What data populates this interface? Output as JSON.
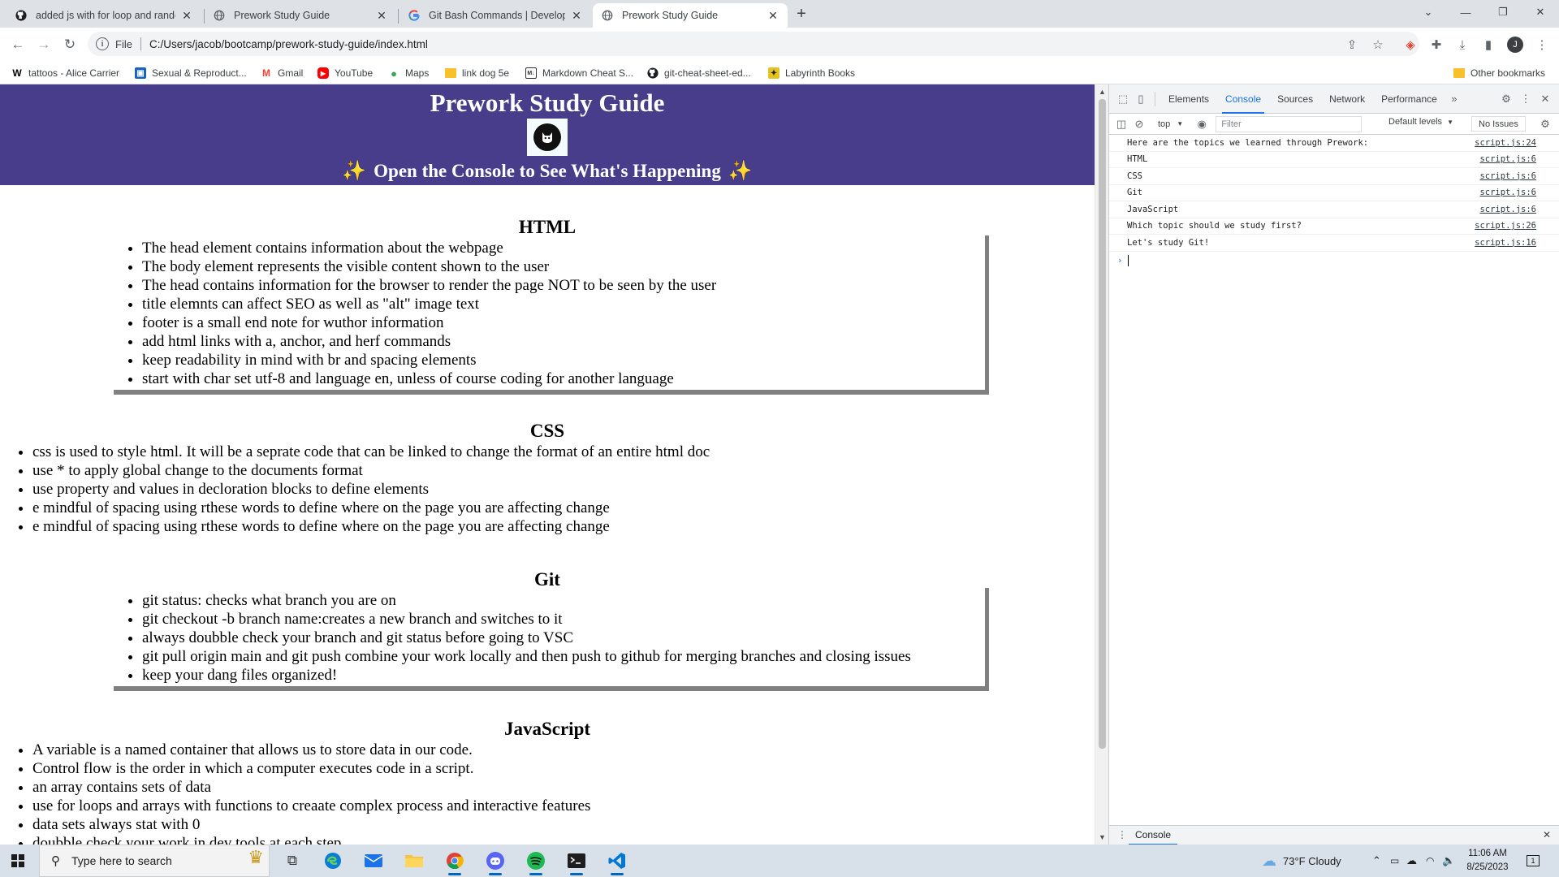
{
  "browser": {
    "tabs": [
      {
        "title": "added js with for loop and rando",
        "icon": "github-icon"
      },
      {
        "title": "Prework Study Guide",
        "icon": "globe-icon"
      },
      {
        "title": "Git Bash Commands | Developers",
        "icon": "google-icon"
      },
      {
        "title": "Prework Study Guide",
        "icon": "globe-icon",
        "active": true
      }
    ],
    "address": {
      "scheme": "File",
      "url": "C:/Users/jacob/bootcamp/prework-study-guide/index.html"
    },
    "profile_initial": "J",
    "bookmarks": [
      {
        "label": "tattoos - Alice Carrier",
        "icon": "w-logo-icon"
      },
      {
        "label": "Sexual & Reproduct...",
        "icon": "page-icon"
      },
      {
        "label": "Gmail",
        "icon": "gmail-icon"
      },
      {
        "label": "YouTube",
        "icon": "youtube-icon"
      },
      {
        "label": "Maps",
        "icon": "maps-icon"
      },
      {
        "label": "link dog 5e",
        "icon": "folder-icon"
      },
      {
        "label": "Markdown Cheat S...",
        "icon": "markdown-icon"
      },
      {
        "label": "git-cheat-sheet-ed...",
        "icon": "github-icon"
      },
      {
        "label": "Labyrinth Books",
        "icon": "labyrinth-icon"
      }
    ],
    "other_bookmarks": "Other bookmarks"
  },
  "page": {
    "title": "Prework Study Guide",
    "subtitle": "Open the Console to See What's Happening",
    "header_bg": "#483d8b",
    "sections": {
      "html": {
        "heading": "HTML",
        "items": [
          "The head element contains information about the webpage",
          "The body element represents the visible content shown to the user",
          "The head contains information for the browser to render the page NOT to be seen by the user",
          "title elemnts can affect SEO as well as \"alt\" image text",
          "footer is a small end note for wuthor information",
          "add html links with a, anchor, and herf commands",
          "keep readability in mind with br and spacing elements",
          "start with char set utf-8 and language en, unless of course coding for another language"
        ]
      },
      "css": {
        "heading": "CSS",
        "items": [
          "css is used to style html. It will be a seprate code that can be linked to change the format of an entire html doc",
          "use * to apply global change to the documents format",
          "use property and values in decloration blocks to define elements",
          "e mindful of spacing using rthese words to define where on the page you are affecting change",
          "e mindful of spacing using rthese words to define where on the page you are affecting change"
        ]
      },
      "git": {
        "heading": "Git",
        "items": [
          "git status: checks what branch you are on",
          "git checkout -b branch name:creates a new branch and switches to it",
          "always doubble check your branch and git status before going to VSC",
          "git pull origin main and git push combine your work locally and then push to github for merging branches and closing issues",
          "keep your dang files organized!"
        ]
      },
      "js": {
        "heading": "JavaScript",
        "items": [
          "A variable is a named container that allows us to store data in our code.",
          "Control flow is the order in which a computer executes code in a script.",
          "an array contains sets of data",
          "use for loops and arrays with functions to creaate complex process and interactive features",
          "data sets always stat with 0",
          "doubble check your work in dev tools at each step"
        ]
      }
    }
  },
  "devtools": {
    "tabs": [
      "Elements",
      "Console",
      "Sources",
      "Network",
      "Performance"
    ],
    "active_tab": "Console",
    "context": "top",
    "filter_placeholder": "Filter",
    "levels": "Default levels",
    "issues": "No Issues",
    "messages": [
      {
        "text": "Here are the topics we learned through Prework:",
        "source": "script.js:24"
      },
      {
        "text": "HTML",
        "source": "script.js:6"
      },
      {
        "text": "CSS",
        "source": "script.js:6"
      },
      {
        "text": "Git",
        "source": "script.js:6"
      },
      {
        "text": "JavaScript",
        "source": "script.js:6"
      },
      {
        "text": "Which topic should we study first?",
        "source": "script.js:26"
      },
      {
        "text": "Let's study Git!",
        "source": "script.js:16"
      }
    ],
    "drawer_tab": "Console"
  },
  "taskbar": {
    "search_placeholder": "Type here to search",
    "weather": "73°F  Cloudy",
    "time": "11:06 AM",
    "date": "8/25/2023",
    "notification_count": "1"
  }
}
